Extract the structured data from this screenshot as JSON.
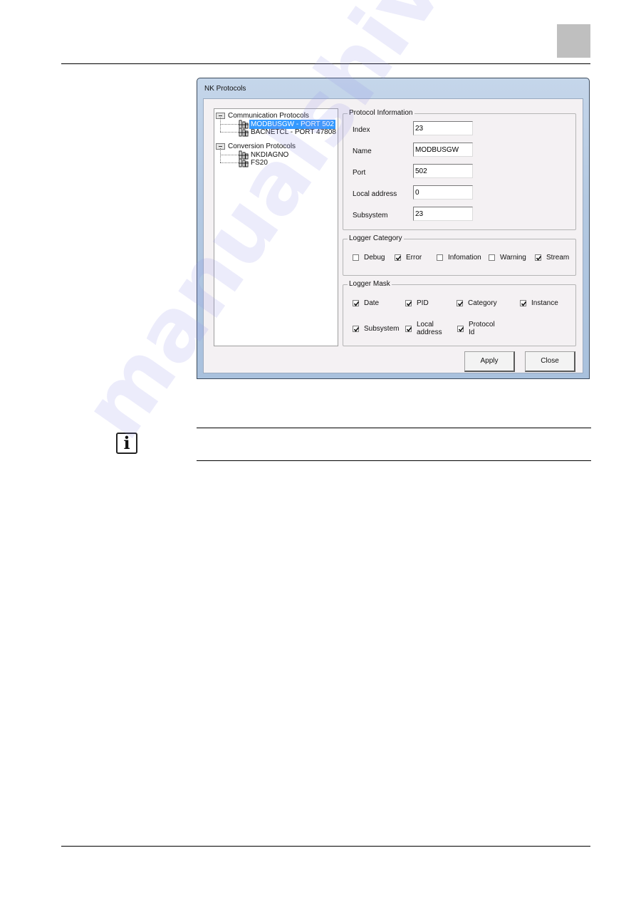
{
  "page": {
    "watermark": "manualshive.com"
  },
  "dialog": {
    "title": "NK Protocols",
    "tree": {
      "groups": [
        {
          "label": "Communication Protocols",
          "children": [
            {
              "label": "MODBUSGW - PORT 502",
              "selected": true
            },
            {
              "label": "BACNETCL - PORT 47808",
              "selected": false
            }
          ]
        },
        {
          "label": "Conversion Protocols",
          "children": [
            {
              "label": "NKDIAGNO",
              "selected": false
            },
            {
              "label": "FS20",
              "selected": false
            }
          ]
        }
      ]
    },
    "protocol_information": {
      "title": "Protocol Information",
      "fields": [
        {
          "label": "Index",
          "value": "23"
        },
        {
          "label": "Name",
          "value": "MODBUSGW"
        },
        {
          "label": "Port",
          "value": "502"
        },
        {
          "label": "Local address",
          "value": "0"
        },
        {
          "label": "Subsystem",
          "value": "23"
        }
      ]
    },
    "logger_category": {
      "title": "Logger Category",
      "options": [
        {
          "label": "Debug",
          "checked": false
        },
        {
          "label": "Error",
          "checked": true
        },
        {
          "label": "Infomation",
          "checked": false
        },
        {
          "label": "Warning",
          "checked": false
        },
        {
          "label": "Stream",
          "checked": true
        }
      ]
    },
    "logger_mask": {
      "title": "Logger Mask",
      "options": [
        {
          "label": "Date",
          "checked": true
        },
        {
          "label": "PID",
          "checked": true
        },
        {
          "label": "Category",
          "checked": true
        },
        {
          "label": "Instance",
          "checked": true
        },
        {
          "label": "Subsystem",
          "checked": true
        },
        {
          "label": "Local\naddress",
          "line1": "Local",
          "line2": "address",
          "checked": true
        },
        {
          "label": "Protocol\nId",
          "line1": "Protocol",
          "line2": "Id",
          "checked": true
        }
      ]
    },
    "buttons": {
      "apply": "Apply",
      "close": "Close"
    }
  },
  "note": {
    "icon": "info-icon"
  }
}
